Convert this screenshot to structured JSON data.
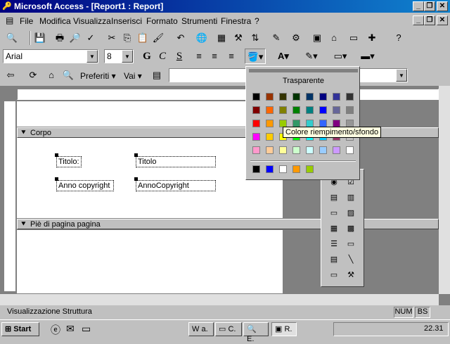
{
  "window": {
    "title": "Microsoft Access - [Report1 : Report]"
  },
  "menu": [
    "File",
    "Modifica",
    "Visualizza",
    "Inserisci",
    "Formato",
    "Strumenti",
    "Finestra",
    "?"
  ],
  "formatting": {
    "font": "Arial",
    "size": "8",
    "bold": "G",
    "italic": "C",
    "underline": "S"
  },
  "webbar": {
    "favorites": "Preferiti",
    "go": "Vai"
  },
  "sections": {
    "body": "Corpo",
    "footer": "Piè di pagina pagina"
  },
  "controls": [
    {
      "label": "Titolo:"
    },
    {
      "label": "Titolo"
    },
    {
      "label": "Anno copyright"
    },
    {
      "label": "AnnoCopyright"
    }
  ],
  "palette": {
    "transparent": "Trasparente",
    "tooltip": "Colore riempimento/sfondo",
    "rows": [
      [
        "#000000",
        "#993300",
        "#333300",
        "#003300",
        "#003366",
        "#000080",
        "#333399",
        "#333333"
      ],
      [
        "#800000",
        "#ff6600",
        "#808000",
        "#008000",
        "#008080",
        "#0000ff",
        "#666699",
        "#808080"
      ],
      [
        "#ff0000",
        "#ff9900",
        "#99cc00",
        "#339966",
        "#33cccc",
        "#3366ff",
        "#800080",
        "#969696"
      ],
      [
        "#ff00ff",
        "#ffcc00",
        "#ffff00",
        "#00ff00",
        "#00ffff",
        "#00ccff",
        "#993366",
        "#c0c0c0"
      ],
      [
        "#ff99cc",
        "#ffcc99",
        "#ffff99",
        "#ccffcc",
        "#ccffff",
        "#99ccff",
        "#cc99ff",
        "#ffffff"
      ]
    ],
    "recent": [
      "#000000",
      "#0000ff",
      "#ffffff",
      "#ff9900",
      "#99cc00"
    ]
  },
  "status": {
    "text": "Visualizzazione Struttura",
    "num": "NUM",
    "bs": "BS"
  },
  "taskbar": {
    "start": "Start",
    "time": "22.31",
    "tasks": [
      "a.",
      "C.",
      "E.",
      "R."
    ]
  }
}
